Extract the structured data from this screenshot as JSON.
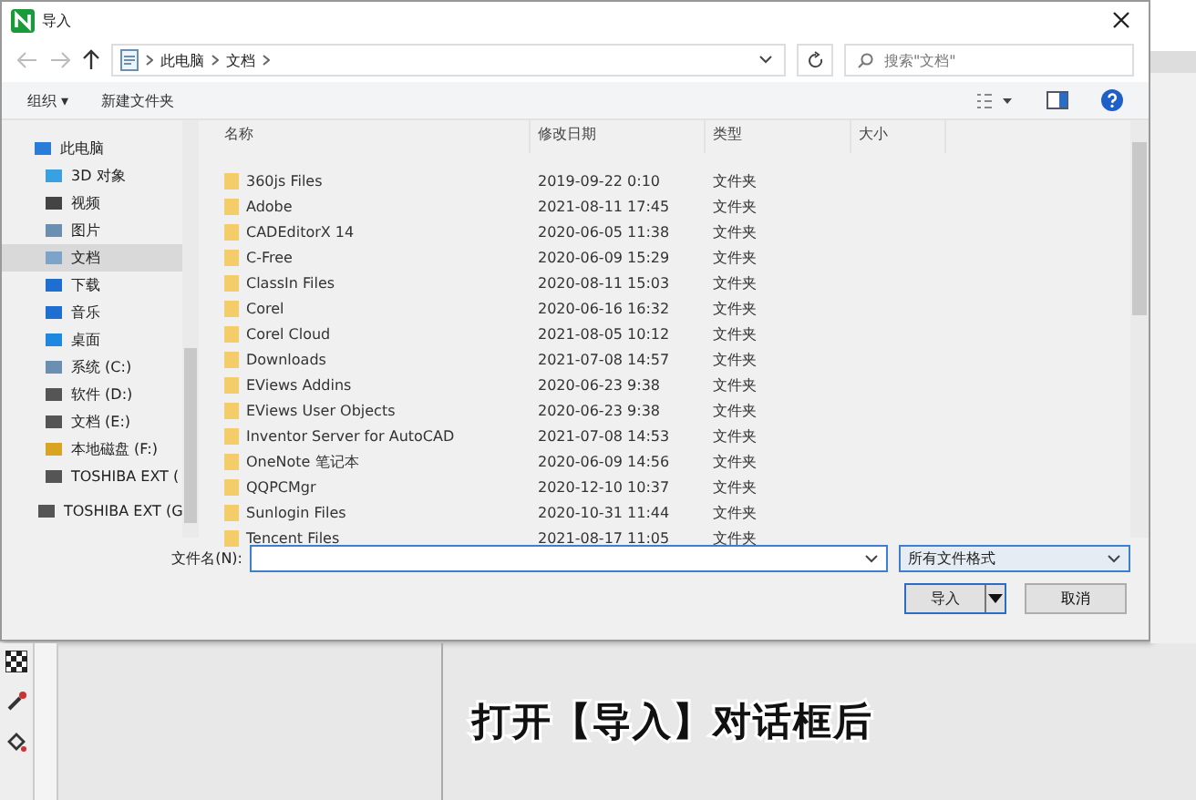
{
  "window": {
    "title": "导入"
  },
  "address": {
    "path": [
      "此电脑",
      "文档"
    ],
    "search_placeholder": "搜索\"文档\""
  },
  "toolbar": {
    "organize": "组织 ▾",
    "new_folder": "新建文件夹"
  },
  "sidebar": {
    "items": [
      {
        "label": "此电脑",
        "kind": "pc",
        "selected": false,
        "children": [
          {
            "label": "3D 对象",
            "kind": "cube",
            "selected": false
          },
          {
            "label": "视频",
            "kind": "video",
            "selected": false
          },
          {
            "label": "图片",
            "kind": "picture",
            "selected": false
          },
          {
            "label": "文档",
            "kind": "document",
            "selected": true
          },
          {
            "label": "下载",
            "kind": "download",
            "selected": false
          },
          {
            "label": "音乐",
            "kind": "music",
            "selected": false
          },
          {
            "label": "桌面",
            "kind": "desktop",
            "selected": false
          },
          {
            "label": "系统 (C:)",
            "kind": "system-drive",
            "selected": false
          },
          {
            "label": "软件 (D:)",
            "kind": "drive",
            "selected": false
          },
          {
            "label": "文档 (E:)",
            "kind": "drive",
            "selected": false
          },
          {
            "label": "本地磁盘 (F:)",
            "kind": "locked-drive",
            "selected": false
          },
          {
            "label": "TOSHIBA EXT (",
            "kind": "drive",
            "selected": false
          }
        ]
      },
      {
        "label": "TOSHIBA EXT (G",
        "kind": "drive",
        "selected": false
      }
    ]
  },
  "table": {
    "columns": [
      "名称",
      "修改日期",
      "类型",
      "大小"
    ],
    "rows": [
      {
        "name": "360js Files",
        "date": "2019-09-22 0:10",
        "type": "文件夹"
      },
      {
        "name": "Adobe",
        "date": "2021-08-11 17:45",
        "type": "文件夹"
      },
      {
        "name": "CADEditorX 14",
        "date": "2020-06-05 11:38",
        "type": "文件夹"
      },
      {
        "name": "C-Free",
        "date": "2020-06-09 15:29",
        "type": "文件夹"
      },
      {
        "name": "ClassIn Files",
        "date": "2020-08-11 15:03",
        "type": "文件夹"
      },
      {
        "name": "Corel",
        "date": "2020-06-16 16:32",
        "type": "文件夹"
      },
      {
        "name": "Corel Cloud",
        "date": "2021-08-05 10:12",
        "type": "文件夹"
      },
      {
        "name": "Downloads",
        "date": "2021-07-08 14:57",
        "type": "文件夹"
      },
      {
        "name": "EViews Addins",
        "date": "2020-06-23 9:38",
        "type": "文件夹"
      },
      {
        "name": "EViews User Objects",
        "date": "2020-06-23 9:38",
        "type": "文件夹"
      },
      {
        "name": "Inventor Server for AutoCAD",
        "date": "2021-07-08 14:53",
        "type": "文件夹"
      },
      {
        "name": "OneNote 笔记本",
        "date": "2020-06-09 14:56",
        "type": "文件夹"
      },
      {
        "name": "QQPCMgr",
        "date": "2020-12-10 10:37",
        "type": "文件夹"
      },
      {
        "name": "Sunlogin Files",
        "date": "2020-10-31 11:44",
        "type": "文件夹"
      },
      {
        "name": "Tencent Files",
        "date": "2021-08-17 11:05",
        "type": "文件夹"
      }
    ]
  },
  "footer": {
    "filename_label": "文件名(N):",
    "filetype": "所有文件格式",
    "import_button": "导入",
    "cancel_button": "取消"
  },
  "caption": "打开【导入】对话框后"
}
